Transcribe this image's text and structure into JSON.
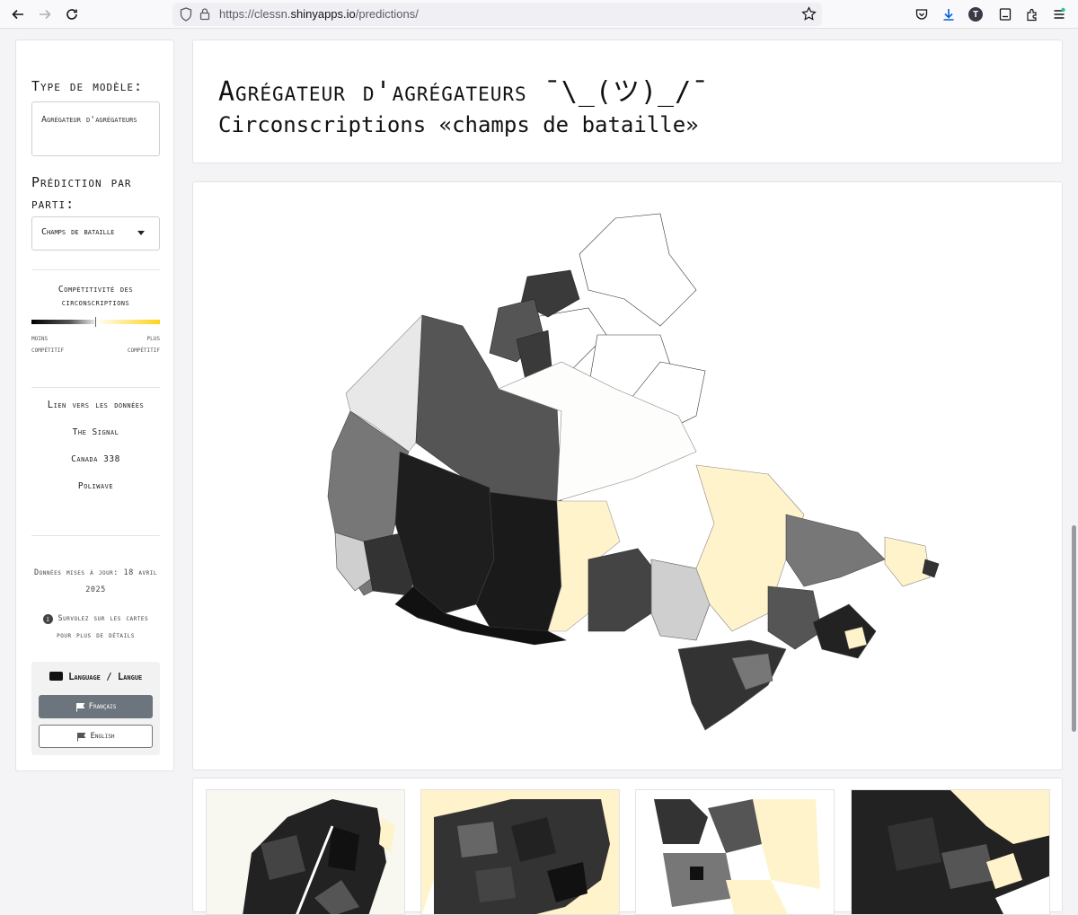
{
  "browser": {
    "url_prefix": "https://clessn.",
    "url_domain": "shinyapps.io",
    "url_path": "/predictions/",
    "avatar_letter": "T"
  },
  "sidebar": {
    "model_heading": "Type de modèle:",
    "model_value": "Agrégateur d'agrégateurs",
    "party_heading": "Prédiction par parti:",
    "party_select": "Champs de bataille",
    "legend_title": "Compétitivité des circonscriptions",
    "legend_left": "moins compétitif",
    "legend_right": "plus compétitif",
    "links_title": "Lien vers les données",
    "links": [
      "The Signal",
      "Canada 338",
      "Poliwave"
    ],
    "updated": "Données mises à jour: 18 avril 2025",
    "hover_hint": "Survolez sur les cartes pour plus de détails",
    "lang_title": "Language / Langue",
    "lang_fr": "Français",
    "lang_en": "English"
  },
  "header": {
    "title": "Agrégateur d'agrégateurs ¯\\_(ツ)_/¯",
    "subtitle": "Circonscriptions «champs de bataille»"
  },
  "colors": {
    "accent_yellow": "#ffd21a",
    "pale_yellow": "#fff3cc",
    "button_gray": "#6c757d"
  }
}
